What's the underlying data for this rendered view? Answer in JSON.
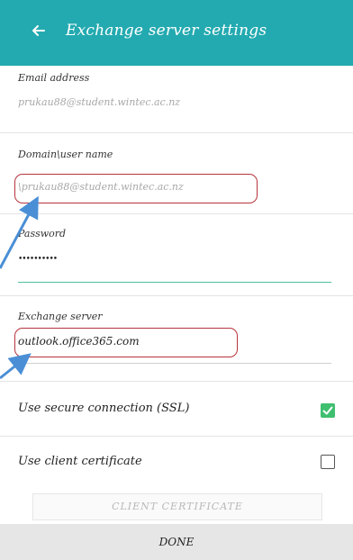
{
  "header": {
    "title": "Exchange server settings",
    "back_icon": "arrow-left-icon",
    "color": "#23aab0"
  },
  "fields": {
    "email_label": "Email address",
    "email_value": "prukau88@student.wintec.ac.nz",
    "domain_label": "Domain\\user name",
    "domain_value": "\\prukau88@student.wintec.ac.nz",
    "password_label": "Password",
    "password_value": "••••••••••",
    "server_label": "Exchange server",
    "server_value": "outlook.office365.com"
  },
  "options": {
    "ssl_label": "Use secure connection (SSL)",
    "ssl_checked": true,
    "client_cert_label": "Use client certificate",
    "client_cert_checked": false
  },
  "buttons": {
    "client_certificate": "CLIENT CERTIFICATE",
    "done": "DONE"
  },
  "annotation_color": "#b5343c",
  "arrow_color": "#4a8fd6"
}
